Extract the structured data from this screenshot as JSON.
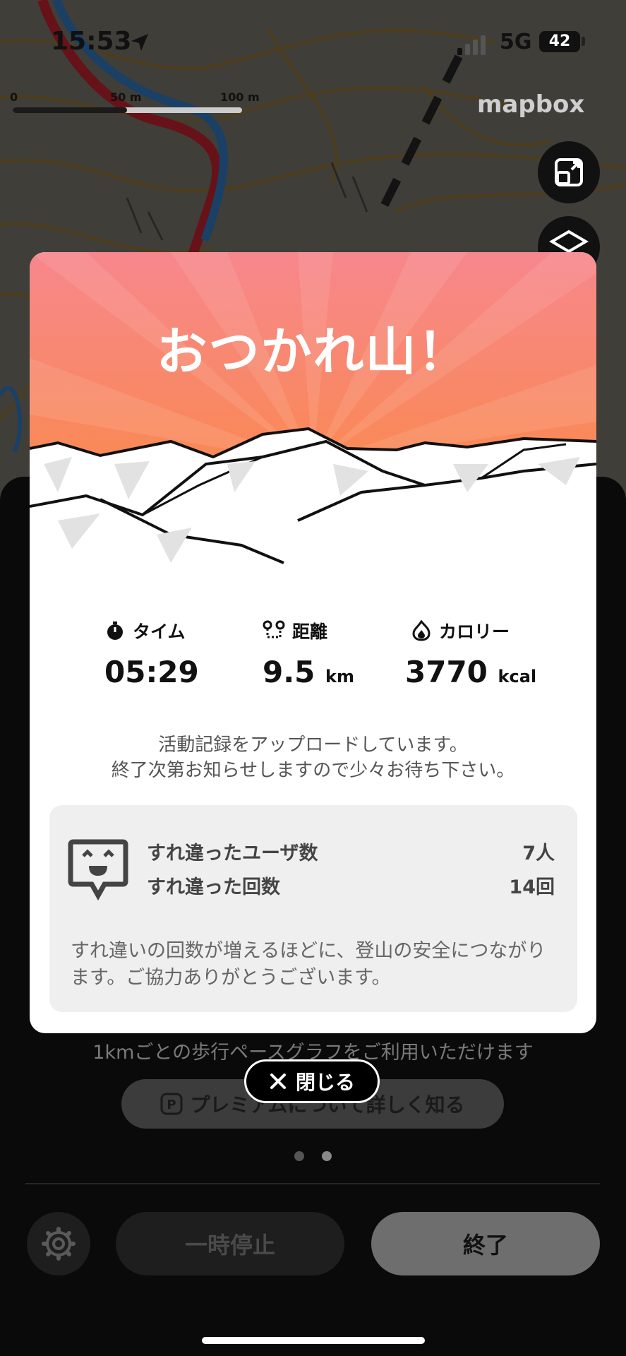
{
  "status_bar": {
    "time": "15:53",
    "network": "5G",
    "battery": "42"
  },
  "map": {
    "scale_labels": [
      "0",
      "50 m",
      "100 m"
    ],
    "attribution": "mapbox"
  },
  "modal": {
    "title": "おつかれ山！",
    "stats": [
      {
        "label": "タイム",
        "value": "05:29",
        "unit": "",
        "icon": "stopwatch-icon"
      },
      {
        "label": "距離",
        "value": "9.5",
        "unit": "km",
        "icon": "route-icon"
      },
      {
        "label": "カロリー",
        "value": "3770",
        "unit": "kcal",
        "icon": "flame-icon"
      }
    ],
    "upload_message_line1": "活動記録をアップロードしています。",
    "upload_message_line2": "終了次第お知らせしますので少々お待ち下さい。",
    "encounter": {
      "users_label": "すれ違ったユーザ数",
      "users_value": "7人",
      "count_label": "すれ違った回数",
      "count_value": "14回",
      "note": "すれ違いの回数が増えるほどに、登山の安全につながります。ご協力ありがとうございます。"
    }
  },
  "close_button": {
    "label": "閉じる"
  },
  "panel": {
    "premium_text": "1kmごとの歩行ペースグラフをご利用いただけます",
    "premium_button": "プレミアムについて詳しく知る",
    "pause_button": "一時停止",
    "end_button": "終了"
  },
  "colors": {
    "hero_top": "#f98a8c",
    "hero_bottom": "#fa8a3c"
  }
}
